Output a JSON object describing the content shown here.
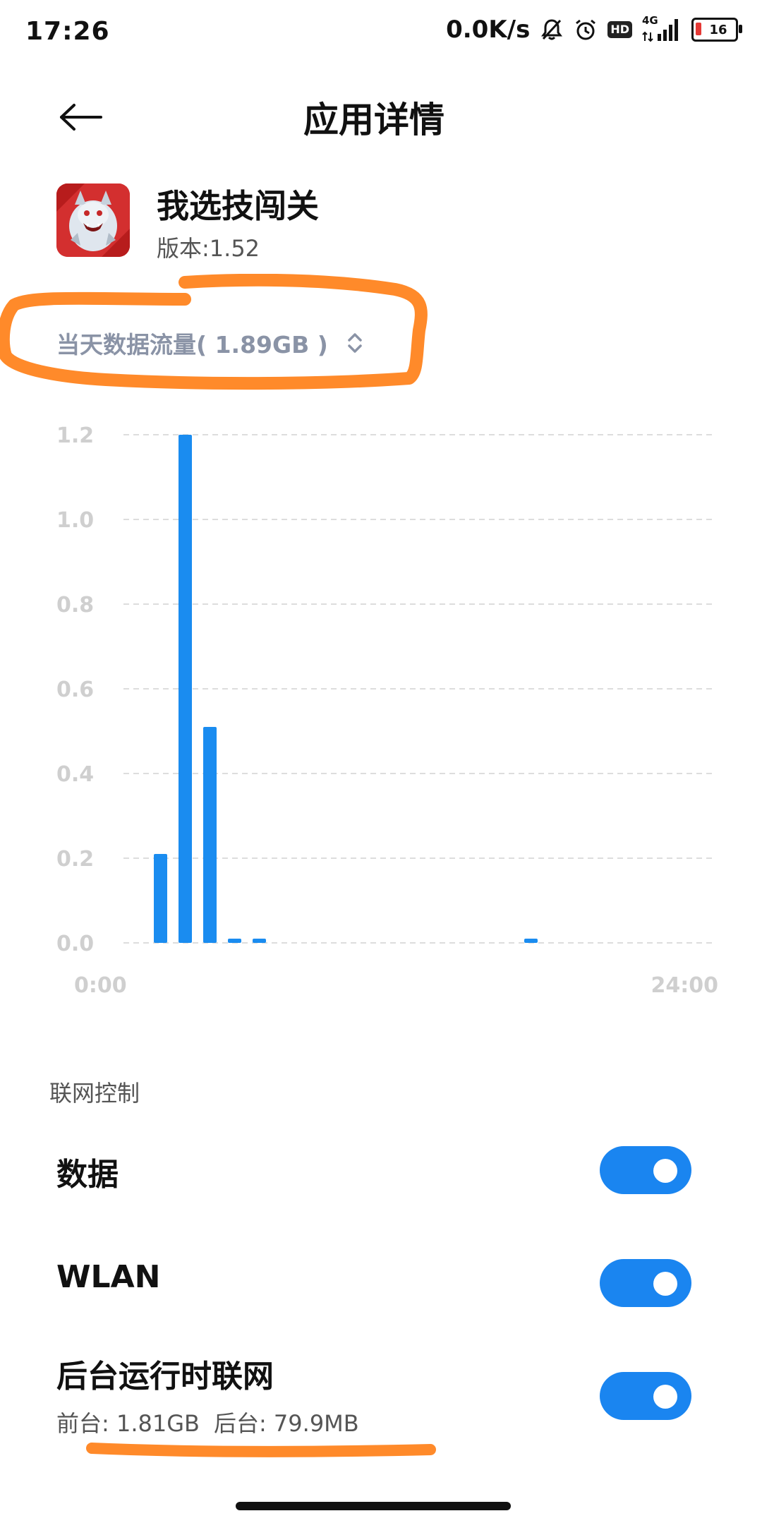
{
  "status_bar": {
    "time": "17:26",
    "net_speed": "0.0K/s",
    "network_type": "4G",
    "hd_label": "HD",
    "battery": "16",
    "icons": [
      "bell-off-icon",
      "alarm-icon",
      "hd-icon",
      "signal-icon",
      "battery-icon"
    ]
  },
  "header": {
    "title": "应用详情",
    "back_icon": "arrow-left-icon"
  },
  "app": {
    "name": "我选技闯关",
    "version": "版本:1.52"
  },
  "usage": {
    "label": "当天数据流量( 1.89GB )",
    "selector_icon": "chevron-up-down-icon"
  },
  "chart_data": {
    "type": "bar",
    "x_start_label": "0:00",
    "x_end_label": "24:00",
    "y_ticks": [
      "1.2",
      "1.0",
      "0.8",
      "0.6",
      "0.4",
      "0.2",
      "0.0"
    ],
    "ylim": [
      0,
      1.2
    ],
    "categories": [
      "0",
      "1",
      "2",
      "3",
      "4",
      "5",
      "6",
      "7",
      "8",
      "9",
      "10",
      "11",
      "12",
      "13",
      "14",
      "15",
      "16",
      "17",
      "18",
      "19",
      "20",
      "21",
      "22",
      "23"
    ],
    "values": [
      0,
      0.21,
      1.2,
      0.51,
      0.01,
      0.01,
      0,
      0,
      0,
      0,
      0,
      0,
      0,
      0,
      0,
      0,
      0.01,
      0,
      0,
      0,
      0,
      0,
      0,
      0
    ],
    "grid": true,
    "bar_color": "#1a8cf0"
  },
  "network_control": {
    "section_label": "联网控制",
    "rows": [
      {
        "title": "数据",
        "enabled": true
      },
      {
        "title": "WLAN",
        "enabled": true
      },
      {
        "title": "后台运行时联网",
        "enabled": true,
        "foreground": "前台: 1.81GB",
        "background": "后台: 79.9MB"
      }
    ]
  },
  "colors": {
    "accent": "#1a85f0",
    "annotation": "#ff8a2a",
    "muted_text": "#8a93a6"
  }
}
